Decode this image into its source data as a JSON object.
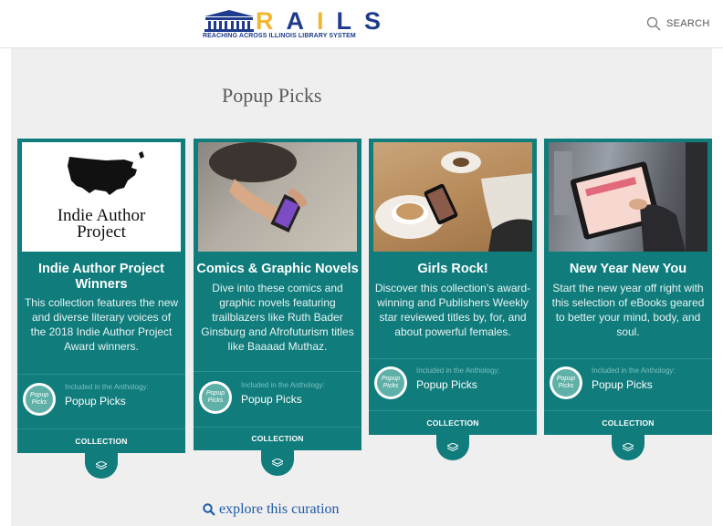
{
  "header": {
    "logo_word": "RAILS",
    "logo_tagline": "REACHING ACROSS ILLINOIS LIBRARY SYSTEM",
    "search_label": "SEARCH"
  },
  "page": {
    "title": "Popup Picks"
  },
  "cards": [
    {
      "title": "Indie Author Project Winners",
      "image_text_1": "Indie Author",
      "image_text_2": "Project",
      "description": "This collection features the new and diverse literary voices of the 2018 Indie Author Project Award winners.",
      "anthology_label": "Included in the Anthology:",
      "anthology_name": "Popup Picks",
      "badge": "COLLECTION"
    },
    {
      "title": "Comics & Graphic Novels",
      "description": "Dive into these comics and graphic novels featuring trailblazers like Ruth Bader Ginsburg and Afrofuturism titles like Baaaad Muthaz.",
      "anthology_label": "Included in the Anthology:",
      "anthology_name": "Popup Picks",
      "badge": "COLLECTION"
    },
    {
      "title": "Girls Rock!",
      "description": "Discover this collection's award-winning and Publishers Weekly star reviewed titles by, for, and about powerful females.",
      "anthology_label": "Included in the Anthology:",
      "anthology_name": "Popup Picks",
      "badge": "COLLECTION"
    },
    {
      "title": "New Year New You",
      "description": "Start the new year off right with this selection of eBooks geared to better your mind, body, and soul.",
      "anthology_label": "Included in the Anthology:",
      "anthology_name": "Popup Picks",
      "badge": "COLLECTION"
    }
  ],
  "anthology_logo_text": "Popup Picks",
  "explore_link": "explore this curation",
  "colors": {
    "teal": "#117c7c",
    "brand_blue": "#1f3c8c",
    "brand_yellow": "#f2b632",
    "link": "#1f5aa6"
  }
}
